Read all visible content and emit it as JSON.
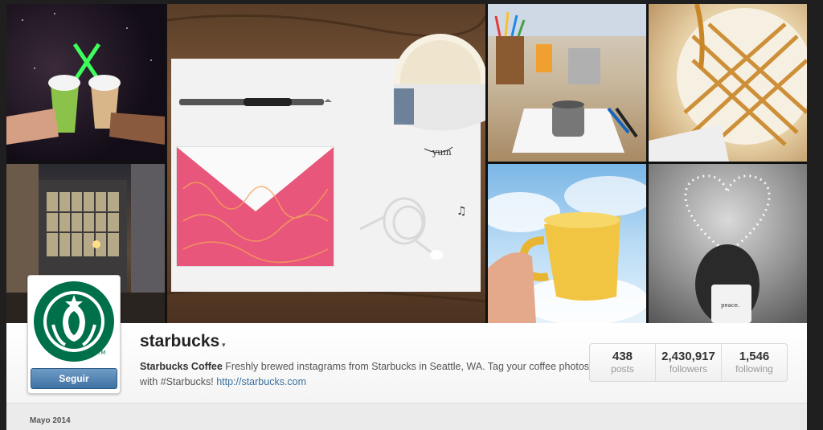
{
  "profile": {
    "username": "starbucks",
    "follow_label": "Seguir",
    "bio_name": "Starbucks Coffee",
    "bio_text": " Freshly brewed instagrams from Starbucks in Seattle, WA. Tag your coffee photos with #Starbucks! ",
    "bio_link": "http://starbucks.com"
  },
  "stats": [
    {
      "value": "438",
      "label": "posts"
    },
    {
      "value": "2,430,917",
      "label": "followers"
    },
    {
      "value": "1,546",
      "label": "following"
    }
  ],
  "feed": {
    "month": "Mayo 2014"
  },
  "colors": {
    "brand_green": "#00704A",
    "button_blue": "#3f72a4",
    "link_blue": "#3b6f9e"
  },
  "icons": {
    "caret": "caret-down-icon"
  }
}
